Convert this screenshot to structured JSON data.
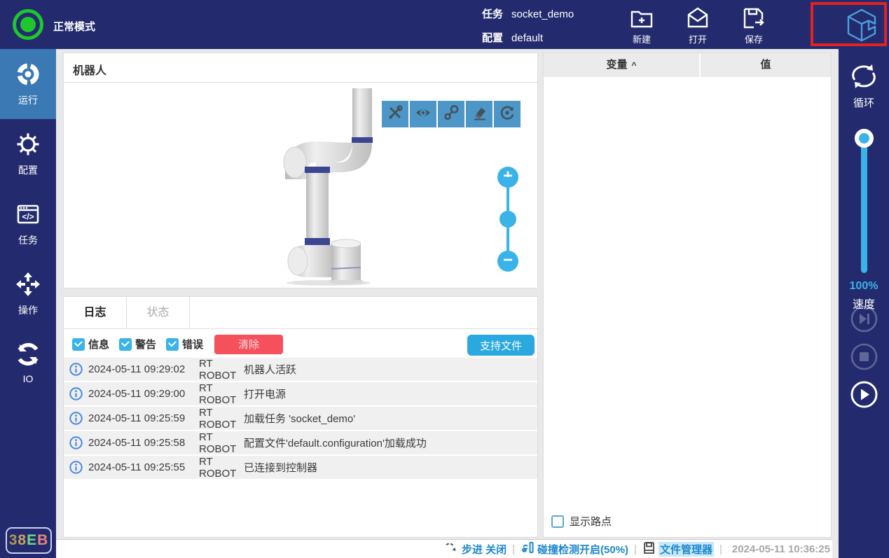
{
  "top_bar": {
    "mode": "正常模式",
    "task_label": "任务",
    "task_value": "socket_demo",
    "config_label": "配置",
    "config_value": "default",
    "new_label": "新建",
    "open_label": "打开",
    "save_label": "保存"
  },
  "left_sidebar": {
    "items": [
      {
        "label": "运行",
        "active": true
      },
      {
        "label": "配置",
        "active": false
      },
      {
        "label": "任务",
        "active": false
      },
      {
        "label": "操作",
        "active": false
      },
      {
        "label": "IO",
        "active": false
      }
    ],
    "badge_chars": [
      "3",
      "8",
      "E",
      "B"
    ],
    "badge_colors": [
      "#b3984e",
      "#c7a35b",
      "#74d584",
      "#e5837e"
    ]
  },
  "robot_panel": {
    "title": "机器人",
    "toolbar_icons": [
      "tools-icon",
      "eye-icon",
      "path-icon",
      "eraser-icon",
      "rotate-icon"
    ],
    "zoom_plus": "+",
    "zoom_minus": "−"
  },
  "log_panel": {
    "tabs": [
      {
        "label": "日志",
        "active": true
      },
      {
        "label": "状态",
        "active": false
      }
    ],
    "filters": [
      {
        "label": "信息",
        "checked": true
      },
      {
        "label": "警告",
        "checked": true
      },
      {
        "label": "错误",
        "checked": true
      }
    ],
    "clear_label": "清除",
    "support_label": "支持文件",
    "entries": [
      {
        "time": "2024-05-11 09:29:02",
        "source": "RT ROBOT",
        "message": "机器人活跃"
      },
      {
        "time": "2024-05-11 09:29:00",
        "source": "RT ROBOT",
        "message": "打开电源"
      },
      {
        "time": "2024-05-11 09:25:59",
        "source": "RT ROBOT",
        "message": "加载任务 'socket_demo'"
      },
      {
        "time": "2024-05-11 09:25:58",
        "source": "RT ROBOT",
        "message": "配置文件'default.configuration'加载成功"
      },
      {
        "time": "2024-05-11 09:25:55",
        "source": "RT ROBOT",
        "message": "已连接到控制器"
      }
    ]
  },
  "variable_panel": {
    "col_variable": "变量",
    "sort_caret": "^",
    "col_value": "值",
    "show_waypoints_label": "显示路点",
    "show_waypoints_checked": false
  },
  "right_sidebar": {
    "loop_label": "循环",
    "speed_value": "100%",
    "speed_label": "速度"
  },
  "status_bar": {
    "step_label": "步进 关闭",
    "collision_label": "碰撞检测开启(50%)",
    "file_manager_label": "文件管理器",
    "timestamp": "2024-05-11 10:36:25",
    "separator": "|"
  },
  "colors": {
    "navy": "#232b6e",
    "active_blue": "#3b79b5",
    "toolbar_blue": "#4c96c8",
    "cyan": "#3ab3e8",
    "support_cyan": "#29a9e0",
    "clear_red": "#f4515c",
    "alert_red_box": "#e12222",
    "status_green": "#1ec72d",
    "logo_blue": "#4aa0dd",
    "link_blue": "#1d87cc"
  }
}
